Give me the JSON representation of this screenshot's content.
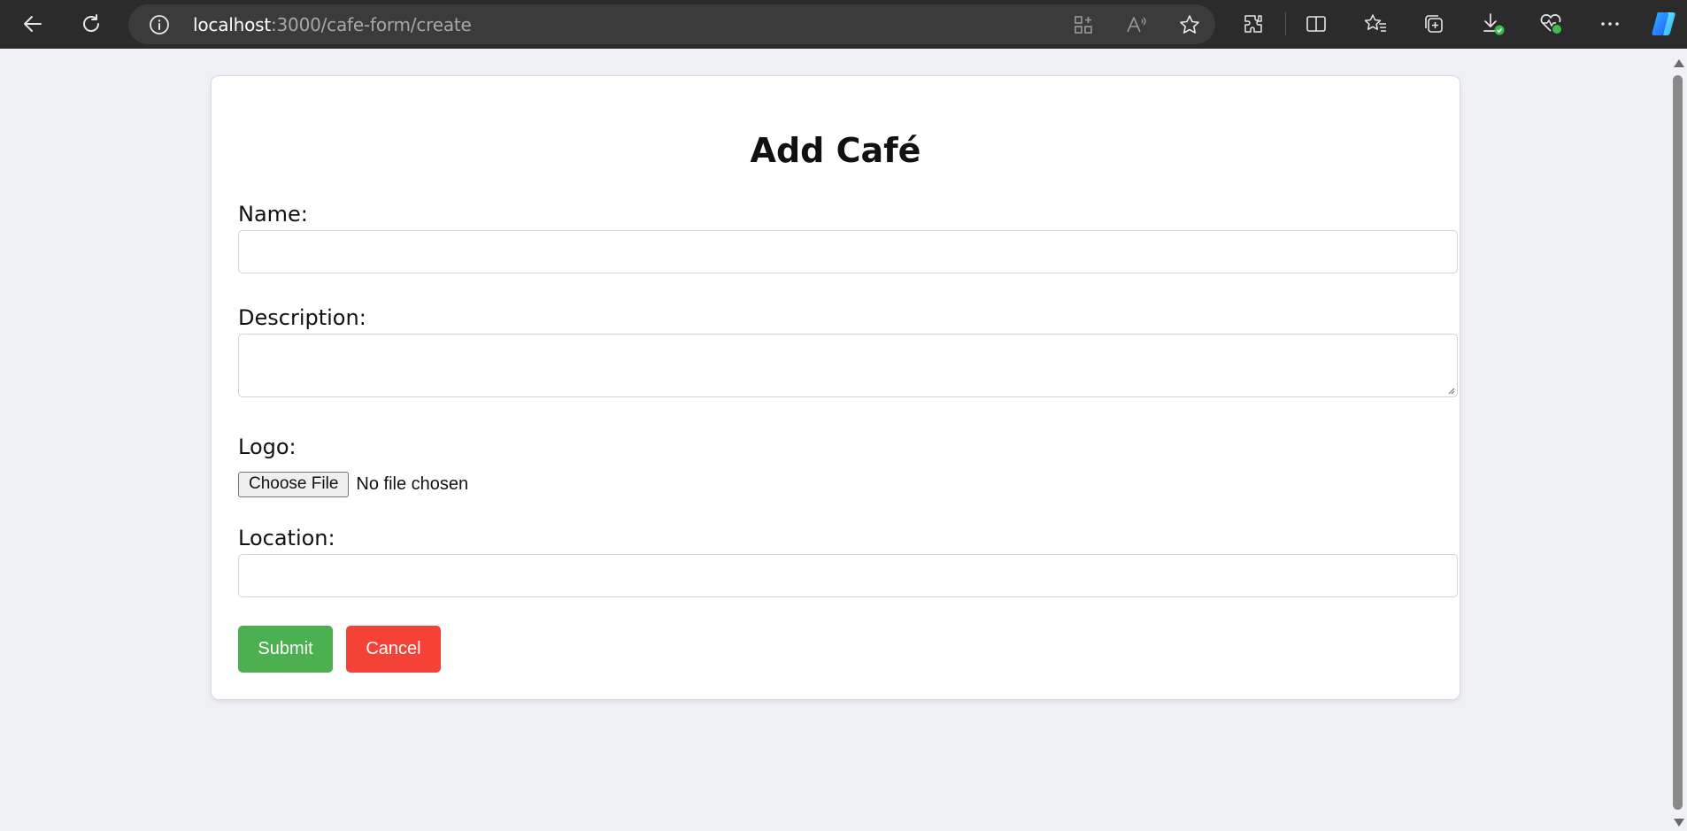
{
  "browser": {
    "url_host": "localhost",
    "url_path": ":3000/cafe-form/create",
    "icons": {
      "back": "back-arrow-icon",
      "refresh": "refresh-icon",
      "info": "info-icon",
      "app_available": "app-available-icon",
      "read_aloud": "read-aloud-icon",
      "favorite": "star-icon",
      "extensions": "extensions-icon",
      "split_screen": "split-screen-icon",
      "favorites": "favorites-icon",
      "collections": "collections-icon",
      "downloads": "downloads-icon",
      "browser_essentials": "browser-essentials-icon",
      "more": "more-icon",
      "copilot": "copilot-icon"
    }
  },
  "form": {
    "title": "Add Café",
    "name_label": "Name:",
    "name_value": "",
    "description_label": "Description:",
    "description_value": "",
    "logo_label": "Logo:",
    "file_button_label": "Choose File",
    "file_status": "No file chosen",
    "location_label": "Location:",
    "location_value": "",
    "submit_label": "Submit",
    "cancel_label": "Cancel"
  },
  "colors": {
    "submit": "#4caf50",
    "cancel": "#f44336",
    "page_bg": "#f0f1f5",
    "chrome_bg": "#2b2b2b"
  }
}
